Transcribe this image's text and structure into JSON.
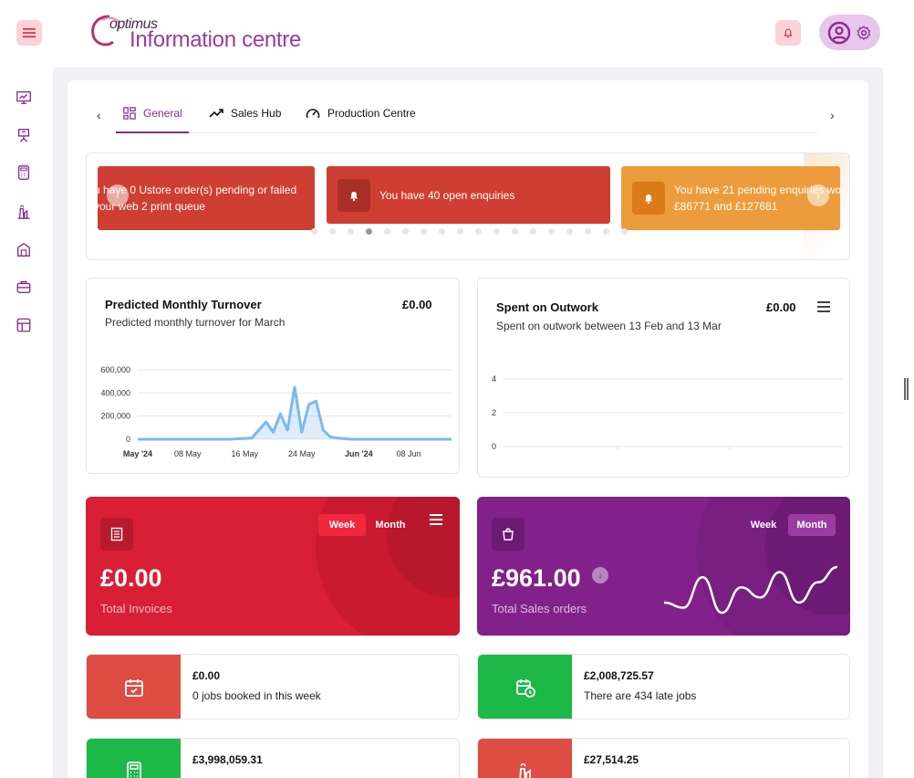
{
  "header": {
    "logo_small": "optimus",
    "logo_big": "Information centre"
  },
  "tabs": [
    {
      "label": "General",
      "icon": "dashboard-icon",
      "active": true
    },
    {
      "label": "Sales Hub",
      "icon": "trending-up-icon",
      "active": false
    },
    {
      "label": "Production Centre",
      "icon": "speedometer-icon",
      "active": false
    }
  ],
  "carousel": {
    "slides": [
      {
        "line1": "u have 0 Ustore order(s) pending or failed",
        "line2": "your web 2 print queue",
        "color": "#cf3e32"
      },
      {
        "line1": "You have 40 open enquiries",
        "line2": "",
        "color": "#cf3e32"
      },
      {
        "line1": "You have 21 pending enquiries wo",
        "line2": "£86771 and £127681",
        "color": "#ec9c3c"
      }
    ],
    "active_dot": 3,
    "dot_count": 18
  },
  "turnover": {
    "title": "Predicted Monthly Turnover",
    "subtitle": "Predicted monthly turnover for March",
    "amount": "£0.00"
  },
  "outwork": {
    "title": "Spent on Outwork",
    "subtitle": "Spent on outwork between 13 Feb and 13 Mar",
    "amount": "£0.00"
  },
  "chart_data": [
    {
      "type": "area",
      "title": "",
      "xlabel": "",
      "ylabel": "",
      "ylim": [
        0,
        600000
      ],
      "yticks": [
        "600,000",
        "400,000",
        "200,000",
        "0"
      ],
      "xticks": [
        "May '24",
        "08 May",
        "16 May",
        "24 May",
        "Jun '24",
        "08 Jun"
      ],
      "x": [
        "2024-05-01",
        "2024-05-05",
        "2024-05-10",
        "2024-05-14",
        "2024-05-17",
        "2024-05-19",
        "2024-05-20",
        "2024-05-21",
        "2024-05-22",
        "2024-05-23",
        "2024-05-24",
        "2024-05-25",
        "2024-05-26",
        "2024-05-27",
        "2024-05-28",
        "2024-05-29",
        "2024-05-30",
        "2024-05-31",
        "2024-06-02",
        "2024-06-05",
        "2024-06-10",
        "2024-06-14"
      ],
      "series": [
        {
          "values": [
            0,
            0,
            0,
            0,
            10000,
            150000,
            60000,
            220000,
            80000,
            450000,
            60000,
            300000,
            330000,
            80000,
            20000,
            10000,
            5000,
            0,
            0,
            0,
            0,
            0
          ]
        }
      ],
      "color": "#7cb9ec",
      "grid": true
    },
    {
      "type": "line",
      "title": "",
      "xlabel": "",
      "ylabel": "",
      "ylim": [
        0,
        4
      ],
      "yticks": [
        "4",
        "2",
        "0"
      ],
      "xticks": [],
      "series": [],
      "grid": true
    }
  ],
  "invoices": {
    "value": "£0.00",
    "label": "Total Invoices",
    "toggle_week": "Week",
    "toggle_month": "Month",
    "active": "Week"
  },
  "sales_orders": {
    "value": "£961.00",
    "label": "Total Sales orders",
    "toggle_week": "Week",
    "toggle_month": "Month",
    "active": "Month",
    "sparkline": [
      3,
      2,
      8,
      1,
      6,
      4,
      9,
      3,
      7,
      10
    ]
  },
  "small_cards": [
    {
      "value": "£0.00",
      "desc": "0 jobs booked in this week",
      "color": "#dd4d44",
      "icon": "calendar-check-icon"
    },
    {
      "value": "£2,008,725.57",
      "desc": "There are 434 late jobs",
      "color": "#1db948",
      "icon": "calendar-clock-icon"
    },
    {
      "value": "£3,998,059.31",
      "desc": "",
      "color": "#1db948",
      "icon": "calculator-icon"
    },
    {
      "value": "£27,514.25",
      "desc": "",
      "color": "#dd4d44",
      "icon": "factory-icon"
    }
  ],
  "colors": {
    "brand": "#8a2b8f",
    "red": "#d81f35",
    "purple": "#82218a"
  }
}
